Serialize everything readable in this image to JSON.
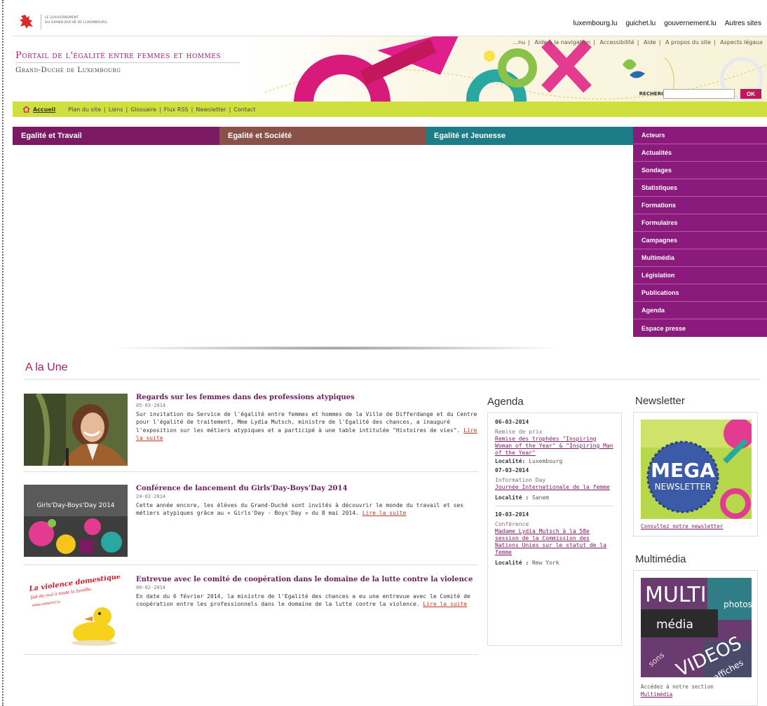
{
  "gov": {
    "line1": "LE GOUVERNEMENT",
    "line2": "DU GRAND-DUCHÉ DE LUXEMBOURG"
  },
  "external_links": [
    "luxembourg.lu",
    "guichet.lu",
    "gouvernement.lu",
    "Autres sites"
  ],
  "header": {
    "title": "Portail de l'égalité entre femmes et hommes",
    "subtitle": "Grand-Duché de Luxembourg",
    "util_links": [
      "...nu",
      "Aide à la navigation",
      "Accessibilité",
      "Aide",
      "A propos du site",
      "Aspects légaux"
    ],
    "search_label": "RECHERCHE :",
    "search_button": "OK"
  },
  "breadcrumb": {
    "home": "Accueil",
    "items": [
      "Plan du site",
      "Liens",
      "Glossaire",
      "Flux RSS",
      "Newsletter",
      "Contact"
    ]
  },
  "tabs": [
    "Egalité et Travail",
    "Egalité et Société",
    "Egalité et Jeunesse"
  ],
  "side_menu": [
    "Acteurs",
    "Actualités",
    "Sondages",
    "Statistiques",
    "Formations",
    "Formulaires",
    "Campagnes",
    "Multimédia",
    "Législation",
    "Publications",
    "Agenda",
    "Espace presse"
  ],
  "une": {
    "title": "A la Une",
    "articles": [
      {
        "title": "Regards sur les femmes dans des professions atypiques",
        "date": "05-03-2014",
        "text": "Sur invitation du Service de l'égalité entre femmes et hommes de la Ville de Differdange et du Centre pour l'égalité de traitement, Mme Lydia Mutsch, ministre de l'Egalité des chances, a inauguré l'exposition sur les métiers atypiques et a participé à une table intitulée \"Histoires de vies\".",
        "more": "Lire la suite"
      },
      {
        "title": "Conférence de lancement du Girls'Day-Boys'Day 2014",
        "date": "24-02-2014",
        "text": "Cette année encore, les élèves du Grand-Duché sont invités à découvrir le monde du travail et ses métiers atypiques grâce au « Girls'Day - Boys'Day » du 8 mai 2014.",
        "more": "Lire la suite",
        "thumb_caption": "Girls'Day-Boys'Day 2014"
      },
      {
        "title": "Entrevue avec le comité de coopération dans le domaine de la lutte contre la violence",
        "date": "06-02-2014",
        "text": "En date du 6 février 2014, la ministre de l'Egalité des chances a eu une entrevue avec le Comité de coopération entre les professionnels dans le domaine de la lutte contre la violence.",
        "more": "Lire la suite",
        "thumb_caption": "La violence domestique",
        "thumb_sub": "fait du mal à toute la famille.",
        "thumb_url": "www.violence.lu"
      }
    ]
  },
  "agenda": {
    "title": "Agenda",
    "events": [
      {
        "date": "06-03-2014",
        "type": "Remise de prix",
        "link": "Remise des trophées \"Inspiring Woman of the Year\" & \"Inspiring Man of the Year\"",
        "loc_label": "Localité:",
        "loc": "Luxembourg"
      },
      {
        "date": "07-03-2014",
        "type": "Information Day",
        "link": "Journée Internationale de la femme",
        "loc_label": "Localité :",
        "loc": "Sanem"
      },
      {
        "date": "10-03-2014",
        "type": "Conférence",
        "link": "Madame Lydia Mutsch à la 58e session de la Commission des Nations Unies sur le statut de la femme",
        "loc_label": "Localité :",
        "loc": "New York"
      }
    ]
  },
  "newsletter": {
    "title": "Newsletter",
    "img_big": "MEGA",
    "img_small": "NEWSLETTER",
    "link": "Consultez notre newsletter"
  },
  "multimedia": {
    "title": "Multimédia",
    "img_words": [
      "MULTI",
      "média",
      "photos",
      "VIDEOS",
      "sons",
      "affiches"
    ],
    "text": "Accédez à notre section",
    "link": "Multimédia"
  },
  "colors": {
    "brand": "#a41d6c",
    "tab_travail": "#7b1962",
    "tab_societe": "#8a5149",
    "tab_jeunesse": "#1c7c87",
    "side_menu": "#8a1a7b",
    "crumb_bar": "#cfe03e"
  }
}
